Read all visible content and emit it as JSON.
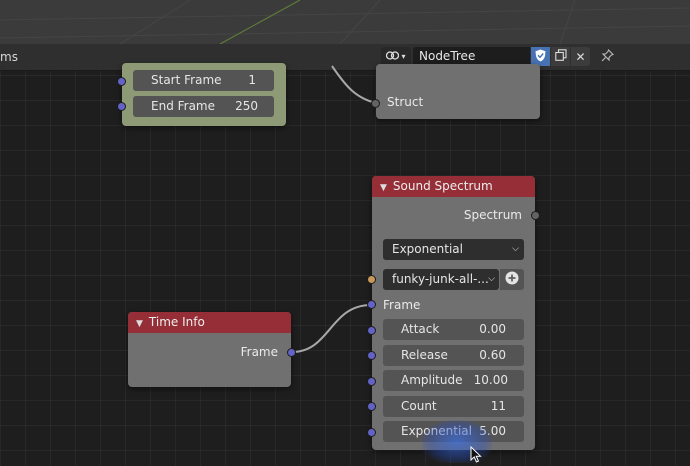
{
  "header": {
    "left_text": "ms",
    "tree_name": "NodeTree",
    "icons": [
      "node-tree-icon",
      "shield-icon",
      "duplicate-icon",
      "close-icon",
      "pin-icon"
    ]
  },
  "frame_range_node": {
    "fields": [
      {
        "label": "Start Frame",
        "value": "1"
      },
      {
        "label": "End Frame",
        "value": "250"
      }
    ]
  },
  "struct_node": {
    "output_label": "Struct"
  },
  "sound_spectrum_node": {
    "title": "Sound Spectrum",
    "output_label": "Spectrum",
    "mode_dropdown": "Exponential",
    "sound_file": "funky-junk-all-...",
    "frame_label": "Frame",
    "fields": [
      {
        "label": "Attack",
        "value": "0.00"
      },
      {
        "label": "Release",
        "value": "0.60"
      },
      {
        "label": "Amplitude",
        "value": "10.00"
      },
      {
        "label": "Count",
        "value": "11"
      },
      {
        "label": "Exponential",
        "value": "5.00"
      }
    ]
  },
  "time_info_node": {
    "title": "Time Info",
    "output_label": "Frame"
  },
  "colors": {
    "header_red": "#952e37",
    "node_body": "#707070",
    "socket_blue": "#6363c7",
    "socket_grey": "#636363",
    "socket_orange": "#c79a5a",
    "frame_node_green": "#8e9a76"
  }
}
